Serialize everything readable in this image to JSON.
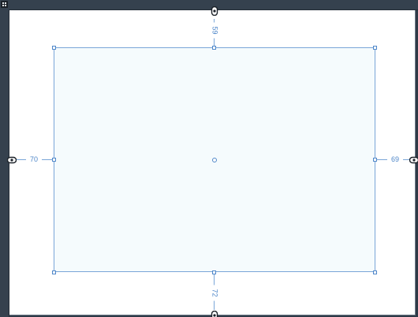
{
  "constraints": {
    "top": "59",
    "bottom": "72",
    "left": "70",
    "right": "69"
  },
  "icons": {
    "corner_menu": "grid-menu-icon",
    "pins": "link-pin-icon",
    "center": "center-point-icon"
  },
  "colors": {
    "frame": "#35414e",
    "canvas": "#ffffff",
    "view_fill": "#f5fbfd",
    "view_border": "#7aa6d8",
    "guide": "#4f87c9"
  }
}
